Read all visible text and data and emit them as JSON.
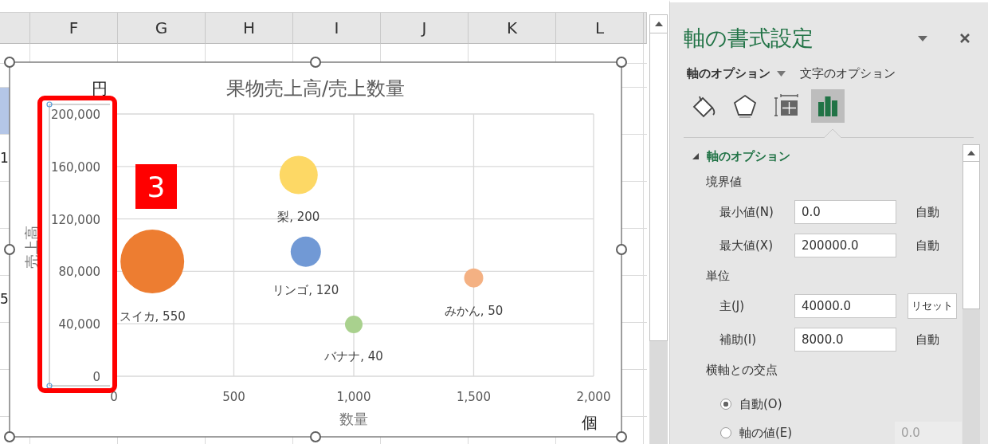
{
  "sheet": {
    "columns": [
      "F",
      "G",
      "H",
      "I",
      "J",
      "K",
      "L"
    ],
    "edge_cells": [
      {
        "kind": "blank"
      },
      {
        "kind": "filled"
      },
      {
        "kind": "text",
        "text": "1"
      },
      {
        "kind": "blank"
      },
      {
        "kind": "blank"
      },
      {
        "kind": "text",
        "text": "5"
      },
      {
        "kind": "blank"
      },
      {
        "kind": "blank"
      }
    ]
  },
  "chart": {
    "y_unit": "円",
    "x_unit": "個",
    "chart_data": {
      "type": "scatter",
      "title": "果物売上高/売上数量",
      "xlabel": "数量",
      "ylabel": "売上高",
      "xlim": [
        0,
        2000
      ],
      "ylim": [
        0,
        200000
      ],
      "grid": true,
      "xticks": [
        {
          "value": 0,
          "label": "0"
        },
        {
          "value": 500,
          "label": "500"
        },
        {
          "value": 1000,
          "label": "1,000"
        },
        {
          "value": 1500,
          "label": "1,500"
        },
        {
          "value": 2000,
          "label": "2,000"
        }
      ],
      "yticks": [
        {
          "value": 0,
          "label": "0"
        },
        {
          "value": 40000,
          "label": "40,000"
        },
        {
          "value": 80000,
          "label": "80,000"
        },
        {
          "value": 120000,
          "label": "120,000"
        },
        {
          "value": 160000,
          "label": "160,000"
        },
        {
          "value": 200000,
          "label": "200,000"
        }
      ],
      "series": [
        {
          "name": "スイカ",
          "color": "#ed7d31",
          "x": [
            160
          ],
          "values": [
            87500
          ]
        },
        {
          "name": "梨",
          "color": "#fdd865",
          "x": [
            770
          ],
          "values": [
            153500
          ]
        },
        {
          "name": "リンゴ",
          "color": "#7199d5",
          "x": [
            800
          ],
          "values": [
            95000
          ]
        },
        {
          "name": "バナナ",
          "color": "#a9d18e",
          "x": [
            1000
          ],
          "values": [
            39500
          ]
        },
        {
          "name": "みかん",
          "color": "#f4b183",
          "x": [
            1500
          ],
          "values": [
            75000
          ]
        }
      ],
      "value_labels": [
        [
          ", 550"
        ],
        [
          ", 200"
        ],
        [
          ", 120"
        ],
        [
          ", 40"
        ],
        [
          ", 50"
        ]
      ]
    }
  },
  "annotation": {
    "badge": "3"
  },
  "pane": {
    "title": "軸の書式設定",
    "tabs": [
      {
        "label": "軸のオプション",
        "selected": true
      },
      {
        "label": "文字のオプション",
        "selected": false
      }
    ],
    "icons": [
      {
        "kind": "fill",
        "selected": false
      },
      {
        "kind": "effects",
        "selected": false
      },
      {
        "kind": "size",
        "selected": false
      },
      {
        "kind": "options",
        "selected": true
      }
    ],
    "section": {
      "title": "軸のオプション",
      "expanded": true
    },
    "items": [
      {
        "kind": "heading",
        "text": "境界値"
      },
      {
        "kind": "field",
        "label": "最小値(N)",
        "value": "0.0",
        "aside": {
          "kind": "text",
          "text": "自動"
        }
      },
      {
        "kind": "field",
        "label": "最大値(X)",
        "value": "200000.0",
        "aside": {
          "kind": "text",
          "text": "自動"
        }
      },
      {
        "kind": "heading",
        "text": "単位"
      },
      {
        "kind": "field",
        "label": "主(J)",
        "value": "40000.0",
        "aside": {
          "kind": "button",
          "text": "リセット"
        }
      },
      {
        "kind": "field",
        "label": "補助(I)",
        "value": "8000.0",
        "aside": {
          "kind": "text",
          "text": "自動"
        }
      },
      {
        "kind": "heading",
        "text": "横軸との交点"
      },
      {
        "kind": "radio",
        "label": "自動(O)",
        "checked": true
      },
      {
        "kind": "radio",
        "label": "軸の値(E)",
        "checked": false,
        "field": {
          "value": "0.0",
          "disabled": true
        }
      }
    ]
  }
}
